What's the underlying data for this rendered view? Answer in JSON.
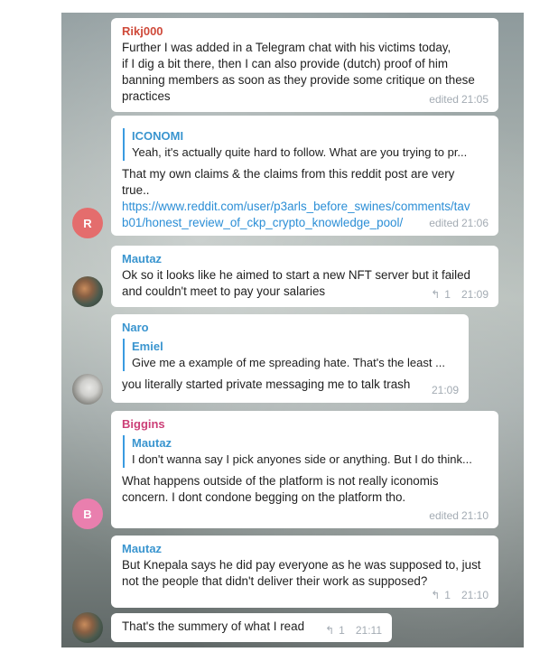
{
  "messages": [
    {
      "sender": "Rikj000",
      "sender_color": "#cf4a3a",
      "text": "Further I was added in a Telegram chat with his victims today,\nif I dig a bit there, then I can also provide (dutch) proof of him\nbanning members as soon as they provide some critique on these\npractices",
      "edited": "edited",
      "time": "21:05"
    },
    {
      "quote_name": "ICONOMI",
      "quote_text": "Yeah, it's actually quite hard to follow. What are you trying to pr...",
      "text": "That my own claims & the claims from this reddit post are very\ntrue..",
      "link": "https://www.reddit.com/user/p3arls_before_swines/comments/tav\nb01/honest_review_of_ckp_crypto_knowledge_pool/",
      "edited": "edited",
      "time": "21:06",
      "avatar_letter": "R",
      "avatar_color": "#e46d6d"
    },
    {
      "sender": "Mautaz",
      "sender_color": "#3a95cf",
      "text": "Ok so it looks like he aimed to start a new NFT server but it failed\nand couldn't meet to pay your salaries",
      "replies": "1",
      "time": "21:09"
    },
    {
      "sender": "Naro",
      "sender_color": "#3a95cf",
      "quote_name": "Emiel",
      "quote_text": "Give me a example of me spreading hate. That's the least ...",
      "text": "you literally started private messaging me to talk trash",
      "time": "21:09"
    },
    {
      "sender": "Biggins",
      "sender_color": "#cc3f77",
      "quote_name": "Mautaz",
      "quote_text": "I don't wanna say I pick anyones side or anything. But I do think...",
      "text": "What happens outside of the platform is not really iconomis\nconcern. I dont condone begging on the platform tho.",
      "edited": "edited",
      "time": "21:10",
      "avatar_letter": "B",
      "avatar_color": "#e97fae"
    },
    {
      "sender": "Mautaz",
      "sender_color": "#3a95cf",
      "text": "But Knepala says he did pay everyone as he was supposed to, just\nnot the people that didn't deliver their work as supposed?",
      "replies": "1",
      "time": "21:10"
    },
    {
      "text": "That's the summery of what I read",
      "replies": "1",
      "time": "21:11"
    }
  ],
  "icons": {
    "reply": "reply-arrow-icon"
  }
}
